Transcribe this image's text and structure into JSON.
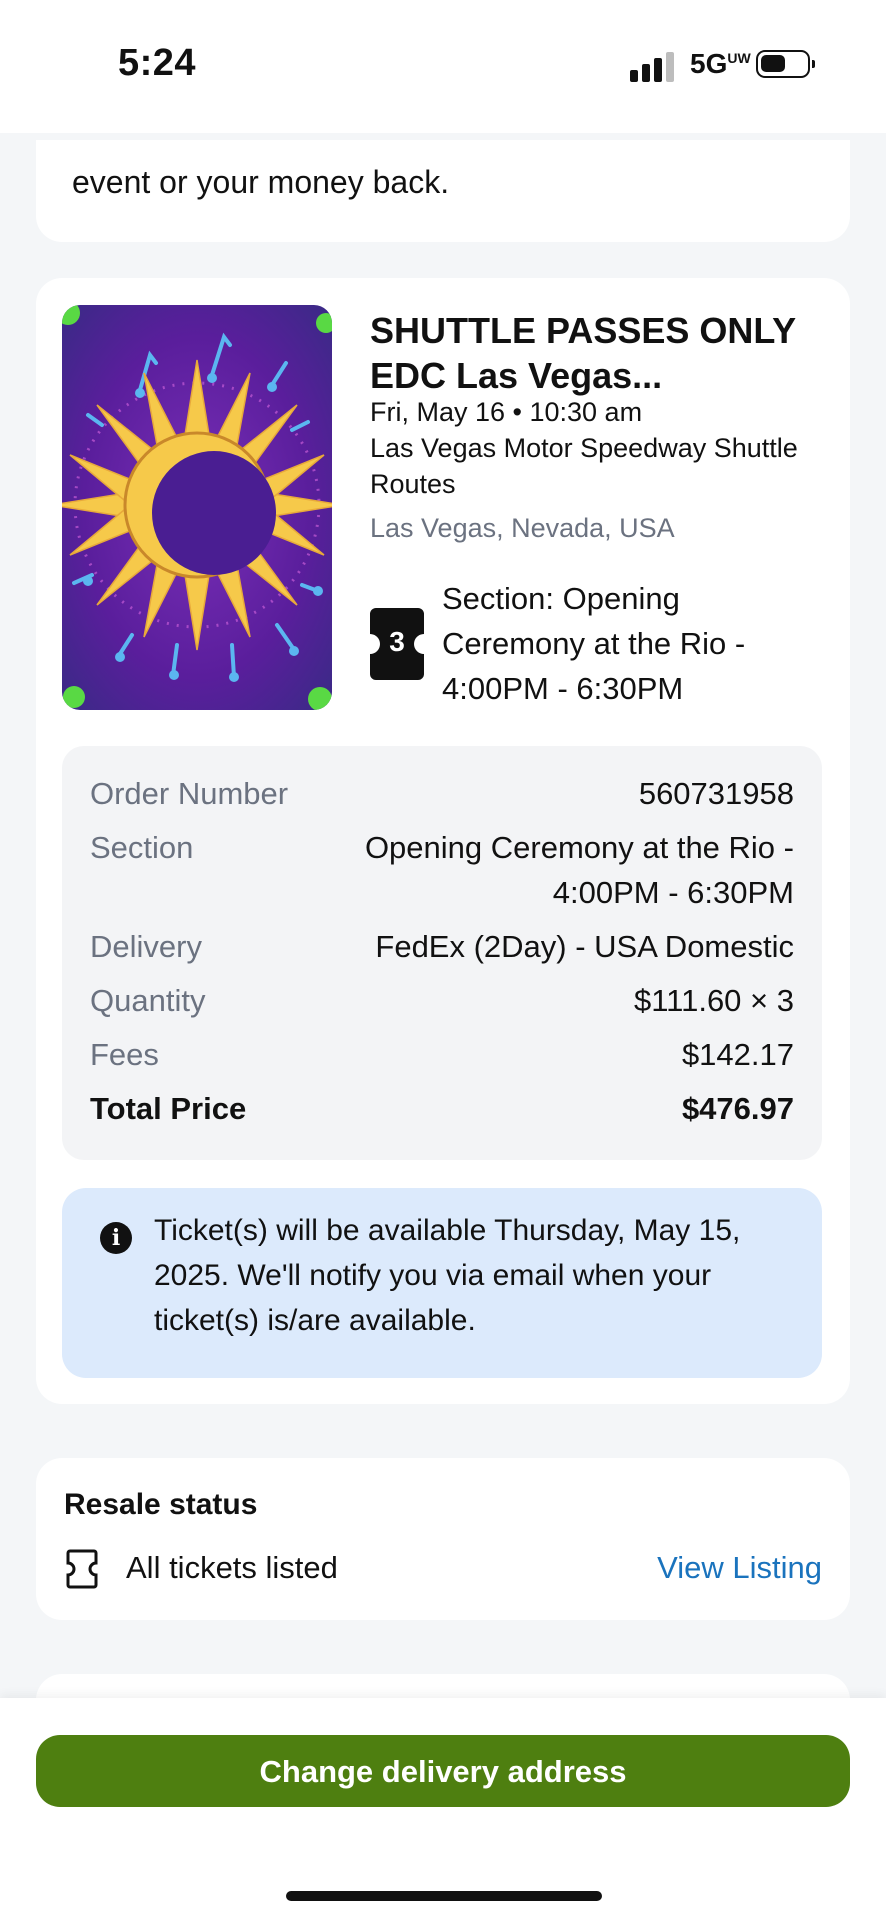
{
  "status_bar": {
    "time": "5:24",
    "network": "5G",
    "network_sup": "UW",
    "icons": [
      "cellular-signal-icon",
      "battery-icon"
    ]
  },
  "top_card": {
    "text": "event or your money back."
  },
  "event": {
    "title": "SHUTTLE PASSES ONLY EDC Las Vegas...",
    "date": "Fri, May 16 • 10:30 am",
    "venue": "Las Vegas Motor Speedway Shuttle Routes",
    "location": "Las Vegas, Nevada, USA",
    "ticket_count": "3",
    "section": "Section: Opening Ceremony at the Rio - 4:00PM - 6:30PM"
  },
  "summary": {
    "order_number_label": "Order Number",
    "order_number": "560731958",
    "section_label": "Section",
    "section_line1": "Opening Ceremony at the Rio -",
    "section_line2": "4:00PM - 6:30PM",
    "delivery_label": "Delivery",
    "delivery": "FedEx (2Day) - USA Domestic",
    "quantity_label": "Quantity",
    "quantity": "$111.60 × 3",
    "fees_label": "Fees",
    "fees": "$142.17",
    "total_label": "Total Price",
    "total": "$476.97"
  },
  "notice": {
    "icon": "info-icon",
    "text": "Ticket(s) will be available Thursday, May 15, 2025. We'll notify you via email when your ticket(s) is/are available."
  },
  "resale": {
    "title": "Resale status",
    "status": "All tickets listed",
    "link": "View Listing"
  },
  "cta": {
    "label": "Change delivery address"
  },
  "colors": {
    "page_bg": "#f4f6f8",
    "cta": "#4e7f10",
    "link": "#1a73bd",
    "notice_bg": "#dceafc"
  }
}
